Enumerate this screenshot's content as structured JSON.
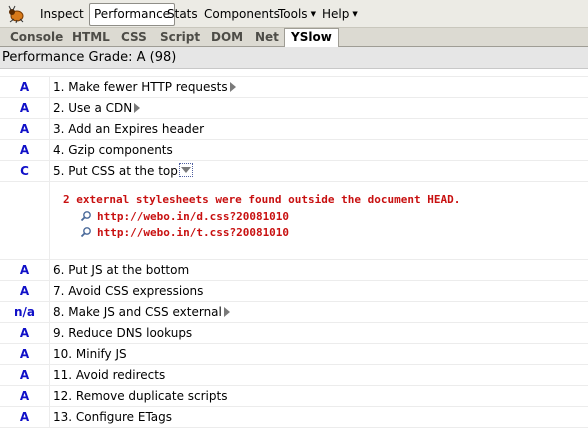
{
  "menu": {
    "items": [
      "Inspect",
      "Performance",
      "Stats",
      "Components",
      "Tools",
      "Help"
    ]
  },
  "tabs": [
    "Console",
    "HTML",
    "CSS",
    "Script",
    "DOM",
    "Net",
    "YSlow"
  ],
  "grade_header": "Performance Grade: A (98)",
  "rules": [
    {
      "grade": "A",
      "label": "1. Make fewer HTTP requests"
    },
    {
      "grade": "A",
      "label": "2. Use a CDN"
    },
    {
      "grade": "A",
      "label": "3. Add an Expires header"
    },
    {
      "grade": "A",
      "label": "4. Gzip components"
    },
    {
      "grade": "C",
      "label": "5. Put CSS at the top"
    },
    {
      "grade": "A",
      "label": "6. Put JS at the bottom"
    },
    {
      "grade": "A",
      "label": "7. Avoid CSS expressions"
    },
    {
      "grade": "n/a",
      "label": "8. Make JS and CSS external"
    },
    {
      "grade": "A",
      "label": "9. Reduce DNS lookups"
    },
    {
      "grade": "A",
      "label": "10. Minify JS"
    },
    {
      "grade": "A",
      "label": "11. Avoid redirects"
    },
    {
      "grade": "A",
      "label": "12. Remove duplicate scripts"
    },
    {
      "grade": "A",
      "label": "13. Configure ETags"
    }
  ],
  "detail": {
    "message": "2 external stylesheets were found outside the document HEAD.",
    "urls": [
      "http://webo.in/d.css?20081010",
      "http://webo.in/t.css?20081010"
    ]
  },
  "colors": {
    "grade_text": "#1010c8",
    "detail_text": "#c81010"
  }
}
